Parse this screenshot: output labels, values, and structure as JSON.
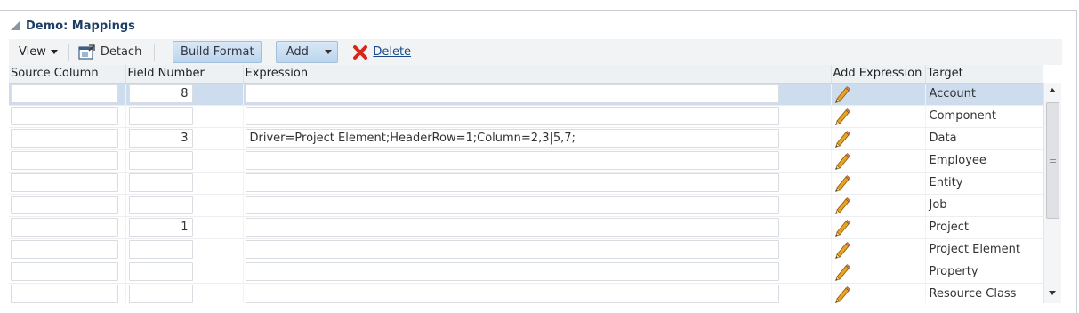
{
  "panel": {
    "title": "Demo: Mappings"
  },
  "toolbar": {
    "view_label": "View",
    "detach_label": "Detach",
    "build_format_label": "Build Format",
    "add_label": "Add",
    "delete_label": "Delete"
  },
  "columns": {
    "source": "Source Column",
    "field": "Field Number",
    "expression": "Expression",
    "add_expression": "Add Expression",
    "target": "Target"
  },
  "rows": [
    {
      "source": "",
      "field": "8",
      "expression": "",
      "target": "Account",
      "selected": true
    },
    {
      "source": "",
      "field": "",
      "expression": "",
      "target": "Component"
    },
    {
      "source": "",
      "field": "3",
      "expression": "Driver=Project Element;HeaderRow=1;Column=2,3|5,7;",
      "target": "Data"
    },
    {
      "source": "",
      "field": "",
      "expression": "",
      "target": "Employee"
    },
    {
      "source": "",
      "field": "",
      "expression": "",
      "target": "Entity"
    },
    {
      "source": "",
      "field": "",
      "expression": "",
      "target": "Job"
    },
    {
      "source": "",
      "field": "1",
      "expression": "",
      "target": "Project"
    },
    {
      "source": "",
      "field": "",
      "expression": "",
      "target": "Project Element"
    },
    {
      "source": "",
      "field": "",
      "expression": "",
      "target": "Property"
    },
    {
      "source": "",
      "field": "",
      "expression": "",
      "target": "Resource Class"
    }
  ],
  "colors": {
    "title": "#1c3e63",
    "selected_row": "#cdddee",
    "button": "#bcd5ec",
    "delete_icon": "#d9261c"
  }
}
